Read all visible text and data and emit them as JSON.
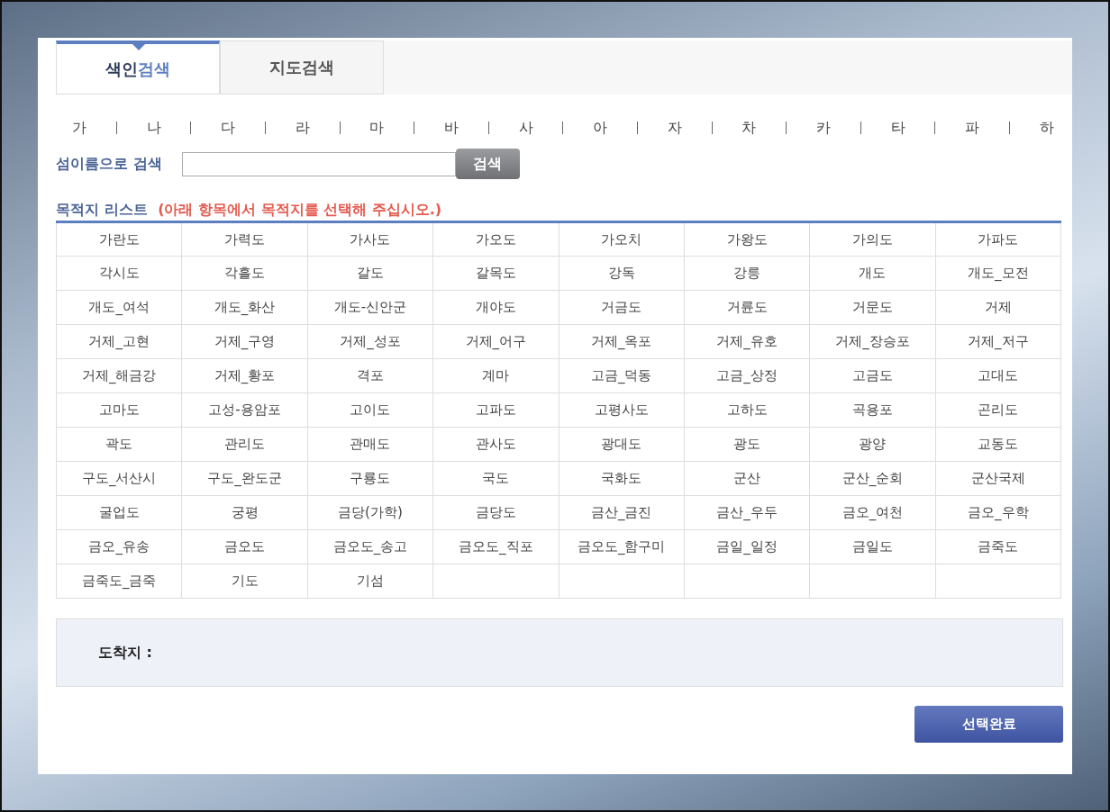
{
  "tabs": [
    {
      "label": [
        {
          "text": "색인",
          "accent": false
        },
        {
          "text": "검색",
          "accent": true
        }
      ],
      "selected": true
    },
    {
      "label": [
        {
          "text": "지도검색",
          "accent": false
        }
      ],
      "selected": false
    }
  ],
  "index_letters": [
    "가",
    "나",
    "다",
    "라",
    "마",
    "바",
    "사",
    "아",
    "자",
    "차",
    "카",
    "타",
    "파",
    "하"
  ],
  "search": {
    "label": "섬이름으로 검색",
    "button": "검색"
  },
  "list_heading": {
    "title": "목적지 리스트",
    "hint": "(아래 항목에서 목적지를 선택해 주십시오.)"
  },
  "destinations": [
    "가란도",
    "가력도",
    "가사도",
    "가오도",
    "가오치",
    "가왕도",
    "가의도",
    "가파도",
    "각시도",
    "각흘도",
    "갈도",
    "갈목도",
    "강독",
    "강릉",
    "개도",
    "개도_모전",
    "개도_여석",
    "개도_화산",
    "개도-신안군",
    "개야도",
    "거금도",
    "거륜도",
    "거문도",
    "거제",
    "거제_고현",
    "거제_구영",
    "거제_성포",
    "거제_어구",
    "거제_옥포",
    "거제_유호",
    "거제_장승포",
    "거제_저구",
    "거제_해금강",
    "거제_황포",
    "격포",
    "계마",
    "고금_덕동",
    "고금_상정",
    "고금도",
    "고대도",
    "고마도",
    "고성-용암포",
    "고이도",
    "고파도",
    "고평사도",
    "고하도",
    "곡용포",
    "곤리도",
    "곽도",
    "관리도",
    "관매도",
    "관사도",
    "광대도",
    "광도",
    "광양",
    "교동도",
    "구도_서산시",
    "구도_완도군",
    "구룡도",
    "국도",
    "국화도",
    "군산",
    "군산_순회",
    "군산국제",
    "굴업도",
    "궁평",
    "금당(가학)",
    "금당도",
    "금산_금진",
    "금산_우두",
    "금오_여천",
    "금오_우학",
    "금오_유송",
    "금오도",
    "금오도_송고",
    "금오도_직포",
    "금오도_함구미",
    "금일_일정",
    "금일도",
    "금죽도",
    "금죽도_금죽",
    "기도",
    "기섬"
  ],
  "arrival": {
    "label": "도착지 :"
  },
  "confirm_button": "선택완료"
}
